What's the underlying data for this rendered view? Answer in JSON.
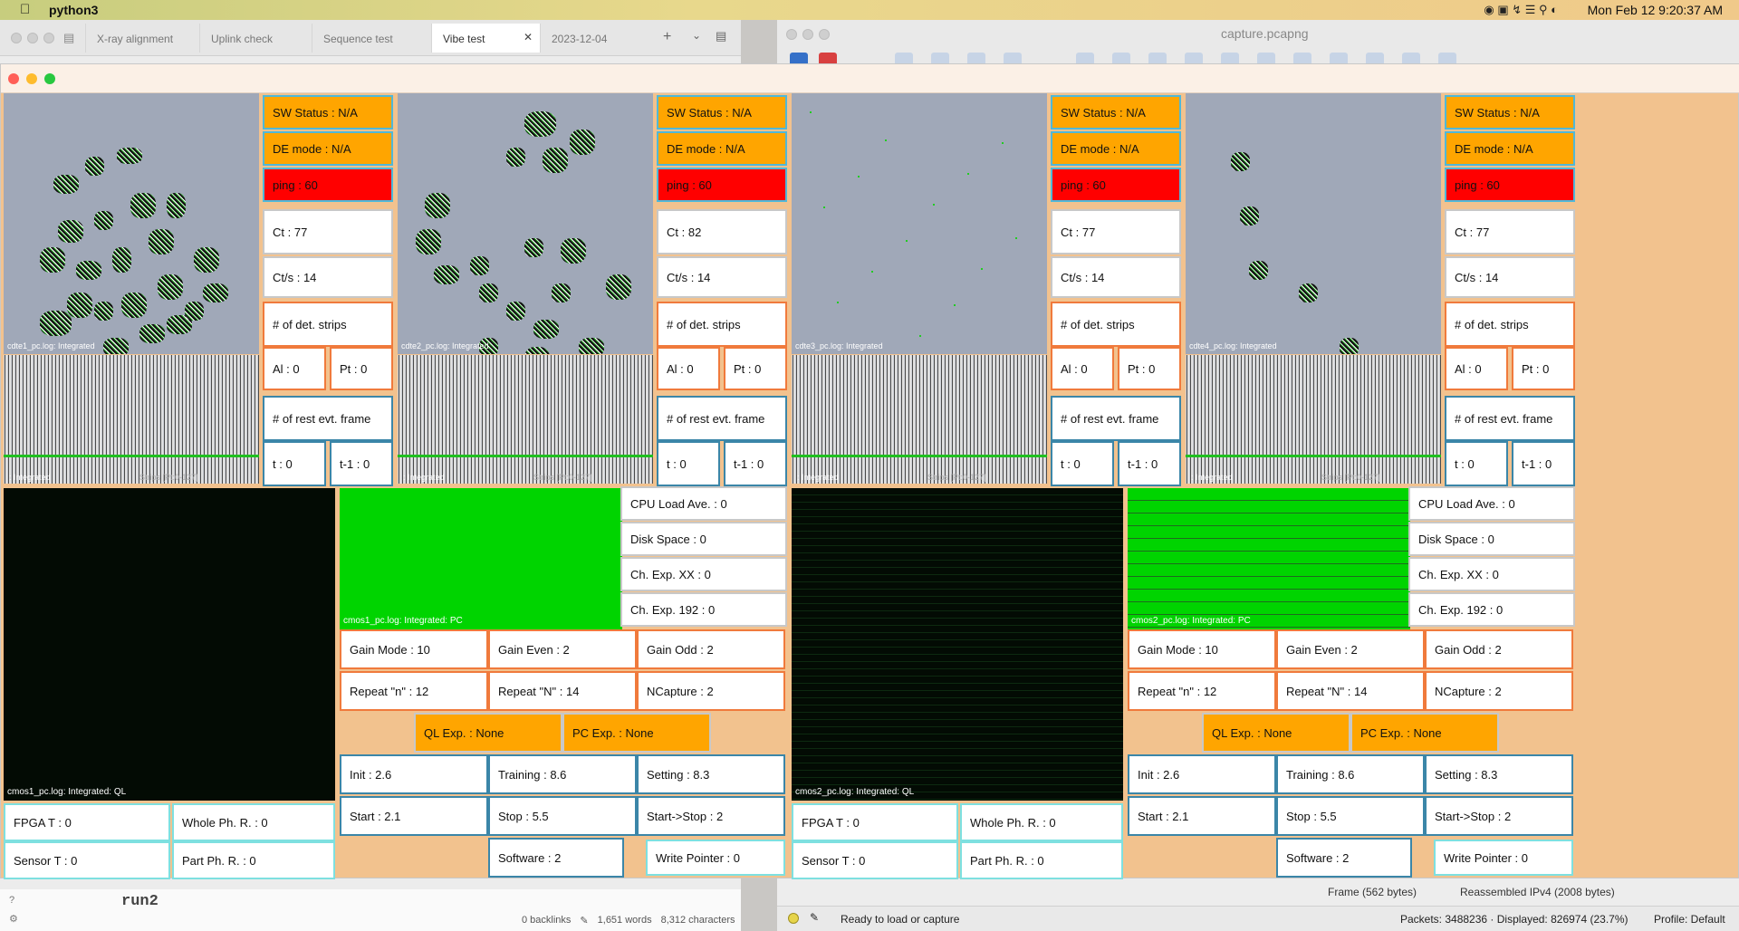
{
  "menubar": {
    "app": "python3",
    "clock": "Mon Feb 12  9:20:37 AM"
  },
  "left_window": {
    "tabs": [
      "X-ray alignment",
      "Uplink check",
      "Sequence test",
      "Vibe test",
      "2023-12-04"
    ],
    "code": "run2",
    "footer": {
      "backlinks": "0 backlinks",
      "words": "1,651 words",
      "chars": "8,312 characters"
    }
  },
  "right_window": {
    "title": "capture.pcapng",
    "status": "Ready to load or capture",
    "panes": [
      "Frame (562 bytes)",
      "Reassembled IPv4 (2008 bytes)"
    ],
    "packets": "Packets: 3488236 · Displayed: 826974 (23.7%)",
    "profile": "Profile: Default"
  },
  "cdte": [
    {
      "caption": "cdte1_pc.log: Integrated",
      "spec_caption": ": Integrated",
      "spec_caption2": "Strips [Pt:0-127]",
      "sw": "SW Status : N/A",
      "de": "DE mode : N/A",
      "ping": "ping : 60",
      "ct": "Ct : 77",
      "cts": "Ct/s : 14",
      "strips": "# of det. strips",
      "al": "Al : 0",
      "pt": "Pt : 0",
      "rest": "# of rest evt. frame",
      "t": "t : 0",
      "t1": "t-1 : 0"
    },
    {
      "caption": "cdte2_pc.log: Integrated",
      "spec_caption": ": Integrated",
      "spec_caption2": "Strips [Pt:0-127]",
      "sw": "SW Status : N/A",
      "de": "DE mode : N/A",
      "ping": "ping : 60",
      "ct": "Ct : 82",
      "cts": "Ct/s : 14",
      "strips": "# of det. strips",
      "al": "Al : 0",
      "pt": "Pt : 0",
      "rest": "# of rest evt. frame",
      "t": "t : 0",
      "t1": "t-1 : 0"
    },
    {
      "caption": "cdte3_pc.log: Integrated",
      "spec_caption": ": Integrated",
      "spec_caption2": "Strips [Pt:0-127]",
      "sw": "SW Status : N/A",
      "de": "DE mode : N/A",
      "ping": "ping : 60",
      "ct": "Ct : 77",
      "cts": "Ct/s : 14",
      "strips": "# of det. strips",
      "al": "Al : 0",
      "pt": "Pt : 0",
      "rest": "# of rest evt. frame",
      "t": "t : 0",
      "t1": "t-1 : 0"
    },
    {
      "caption": "cdte4_pc.log: Integrated",
      "spec_caption": ": Integrated",
      "spec_caption2": "Strips [Pt:0-127]",
      "sw": "SW Status : N/A",
      "de": "DE mode : N/A",
      "ping": "ping : 60",
      "ct": "Ct : 77",
      "cts": "Ct/s : 14",
      "strips": "# of det. strips",
      "al": "Al : 0",
      "pt": "Pt : 0",
      "rest": "# of rest evt. frame",
      "t": "t : 0",
      "t1": "t-1 : 0"
    }
  ],
  "cmos": [
    {
      "ql_caption": "cmos1_pc.log: Integrated: QL",
      "pc_caption": "cmos1_pc.log: Integrated: PC",
      "cpu": "CPU Load Ave. : 0",
      "disk": "Disk Space : 0",
      "chxx": "Ch. Exp. XX : 0",
      "ch192": "Ch. Exp. 192 : 0",
      "gain_mode": "Gain Mode : 10",
      "gain_even": "Gain Even : 2",
      "gain_odd": "Gain Odd : 2",
      "repeat_n": "Repeat \"n\" : 12",
      "repeat_N": "Repeat \"N\" : 14",
      "ncapture": "NCapture : 2",
      "ql_exp": "QL Exp. : None",
      "pc_exp": "PC Exp. : None",
      "init": "Init : 2.6",
      "training": "Training : 8.6",
      "setting": "Setting : 8.3",
      "start": "Start : 2.1",
      "stop": "Stop : 5.5",
      "start_stop": "Start->Stop : 2",
      "software": "Software : 2",
      "write_pointer": "Write Pointer : 0",
      "fpga": "FPGA T : 0",
      "whole": "Whole Ph. R. : 0",
      "sensor": "Sensor T : 0",
      "part": "Part Ph. R. : 0"
    },
    {
      "ql_caption": "cmos2_pc.log: Integrated: QL",
      "pc_caption": "cmos2_pc.log: Integrated: PC",
      "cpu": "CPU Load Ave. : 0",
      "disk": "Disk Space : 0",
      "chxx": "Ch. Exp. XX : 0",
      "ch192": "Ch. Exp. 192 : 0",
      "gain_mode": "Gain Mode : 10",
      "gain_even": "Gain Even : 2",
      "gain_odd": "Gain Odd : 2",
      "repeat_n": "Repeat \"n\" : 12",
      "repeat_N": "Repeat \"N\" : 14",
      "ncapture": "NCapture : 2",
      "ql_exp": "QL Exp. : None",
      "pc_exp": "PC Exp. : None",
      "init": "Init : 2.6",
      "training": "Training : 8.6",
      "setting": "Setting : 8.3",
      "start": "Start : 2.1",
      "stop": "Stop : 5.5",
      "start_stop": "Start->Stop : 2",
      "software": "Software : 2",
      "write_pointer": "Write Pointer : 0",
      "fpga": "FPGA T : 0",
      "whole": "Whole Ph. R. : 0",
      "sensor": "Sensor T : 0",
      "part": "Part Ph. R. : 0"
    }
  ],
  "colors": {
    "orange": "#ffa500",
    "red": "#ff0000",
    "green": "#00d400",
    "panel_bg": "#f2c28e"
  }
}
